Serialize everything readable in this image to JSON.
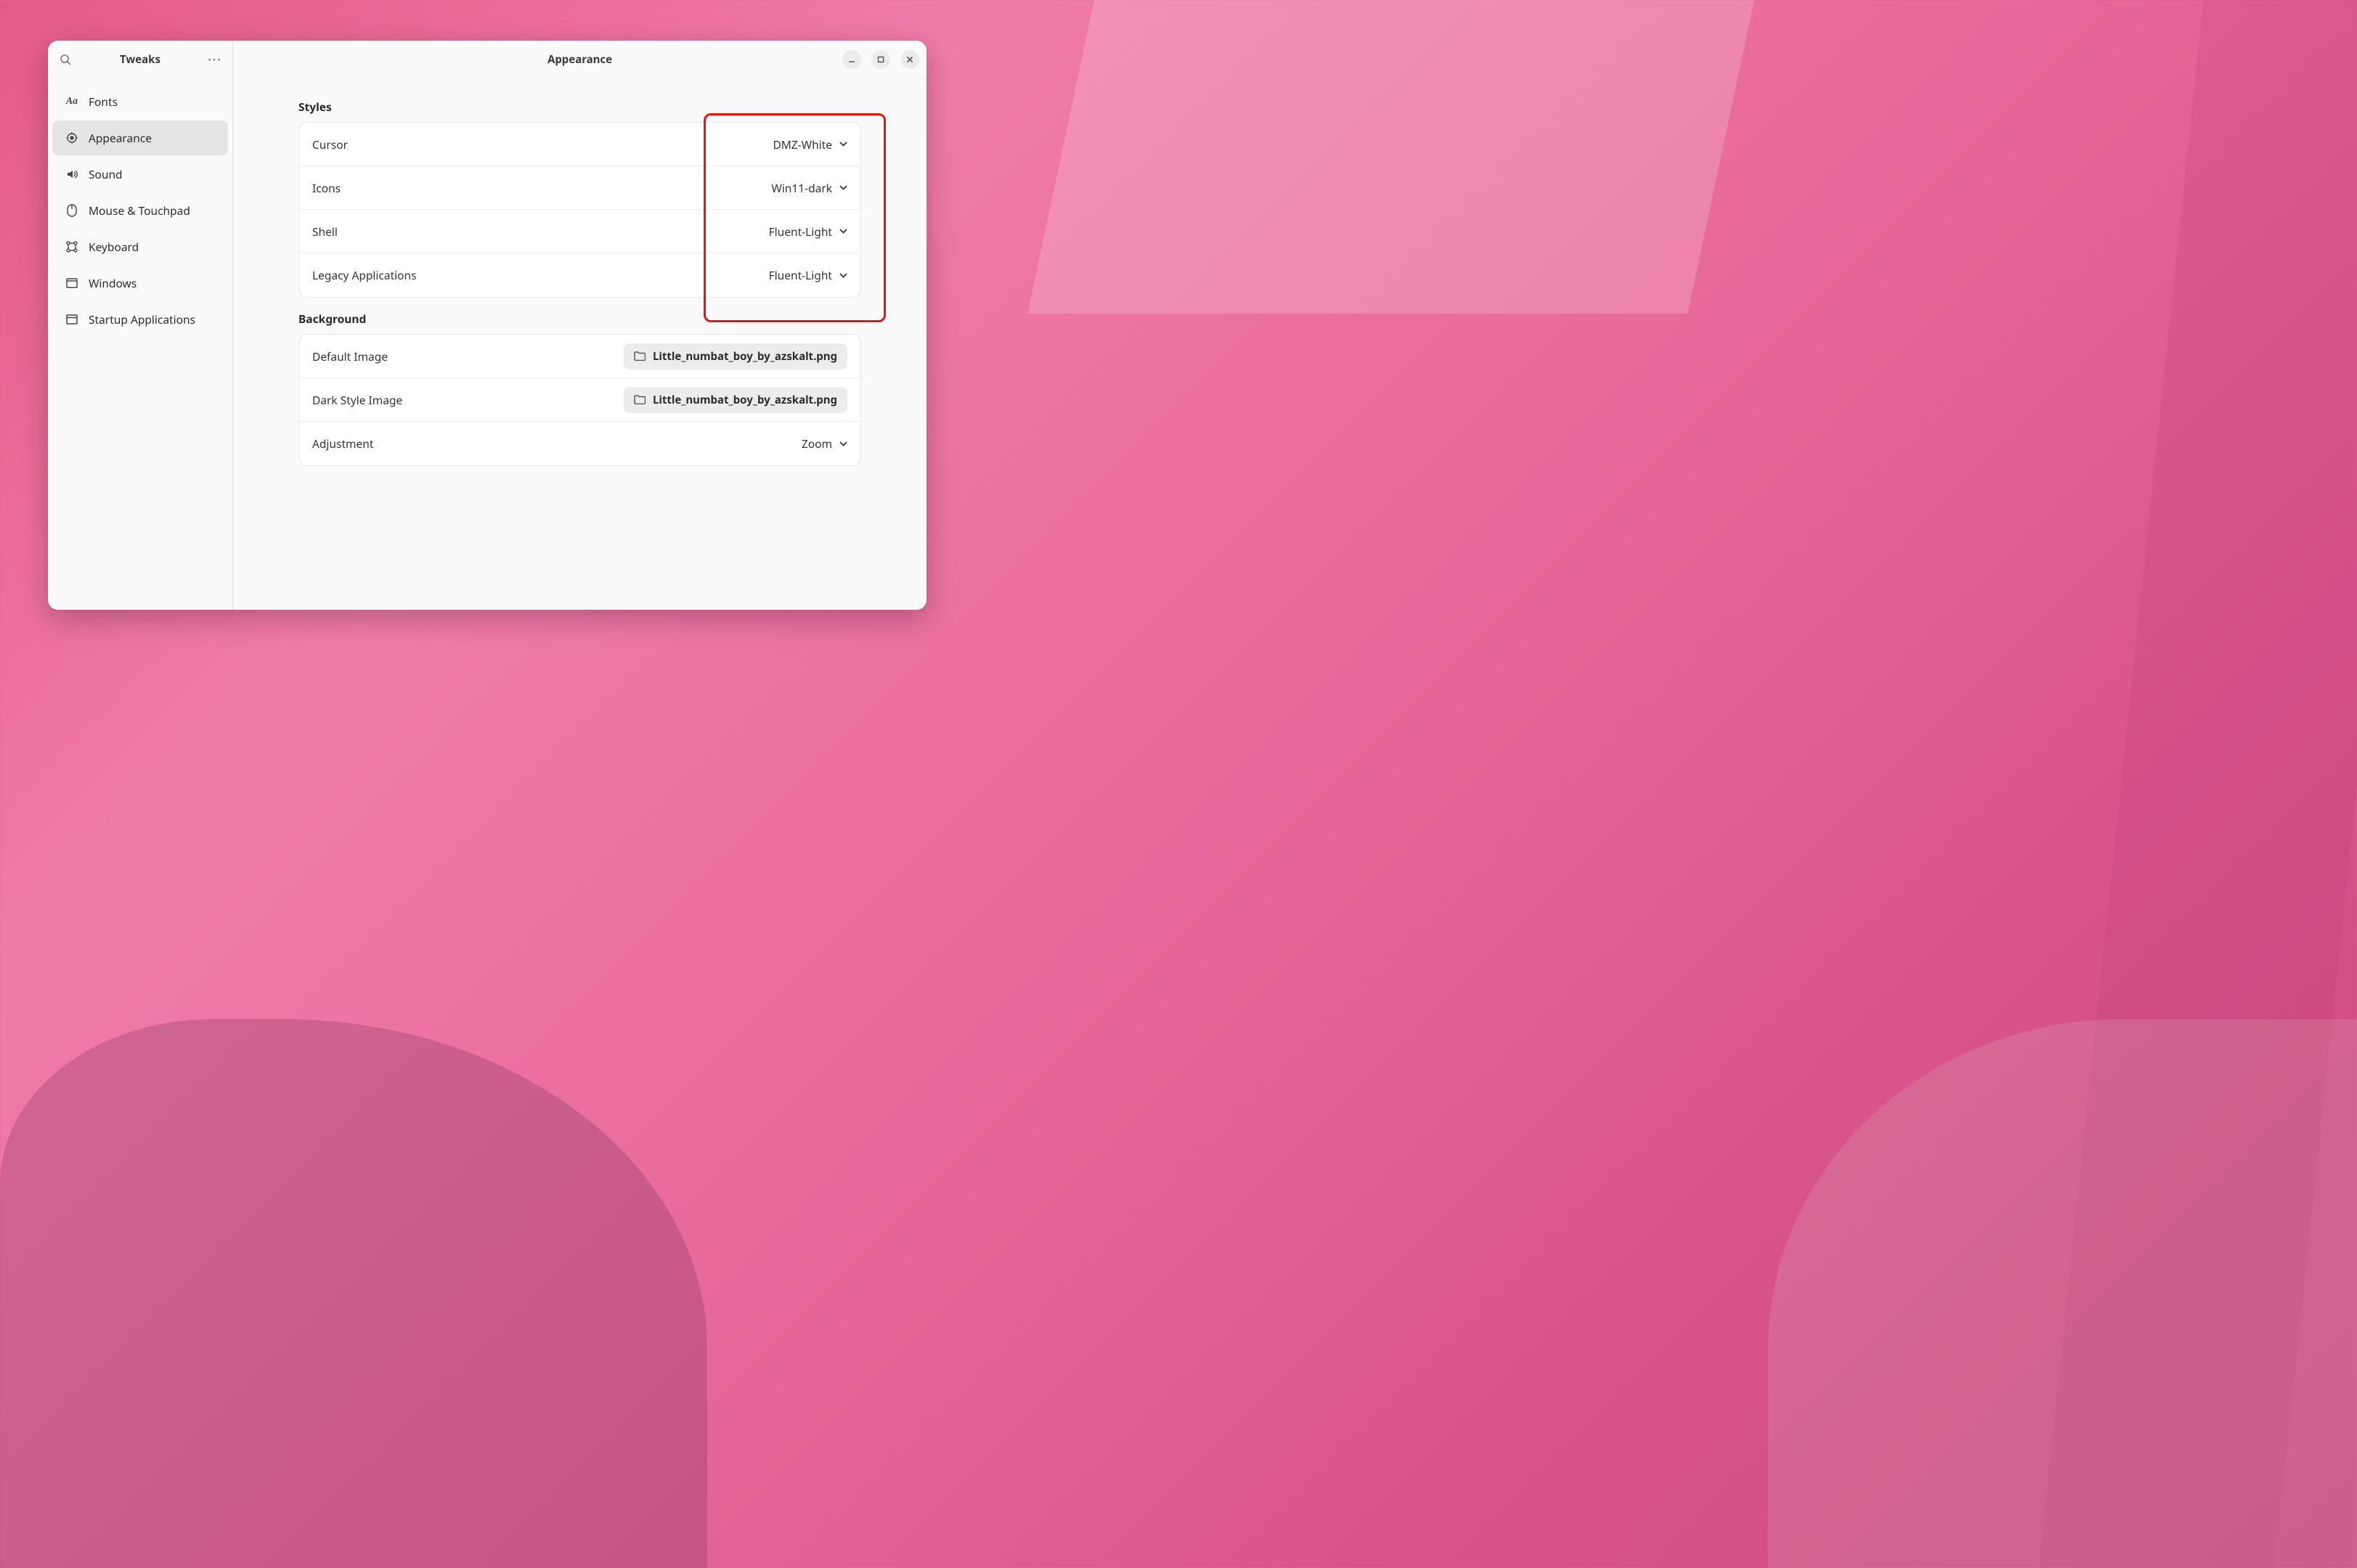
{
  "app": {
    "title": "Tweaks"
  },
  "header": {
    "title": "Appearance"
  },
  "sidebar": {
    "items": [
      {
        "label": "Fonts"
      },
      {
        "label": "Appearance"
      },
      {
        "label": "Sound"
      },
      {
        "label": "Mouse & Touchpad"
      },
      {
        "label": "Keyboard"
      },
      {
        "label": "Windows"
      },
      {
        "label": "Startup Applications"
      }
    ]
  },
  "sections": {
    "styles": {
      "heading": "Styles",
      "rows": {
        "cursor": {
          "label": "Cursor",
          "value": "DMZ-White"
        },
        "icons": {
          "label": "Icons",
          "value": "Win11-dark"
        },
        "shell": {
          "label": "Shell",
          "value": "Fluent-Light"
        },
        "legacy": {
          "label": "Legacy Applications",
          "value": "Fluent-Light"
        }
      }
    },
    "background": {
      "heading": "Background",
      "rows": {
        "default_img": {
          "label": "Default Image",
          "file": "Little_numbat_boy_by_azskalt.png"
        },
        "dark_img": {
          "label": "Dark Style Image",
          "file": "Little_numbat_boy_by_azskalt.png"
        },
        "adjustment": {
          "label": "Adjustment",
          "value": "Zoom"
        }
      }
    }
  }
}
